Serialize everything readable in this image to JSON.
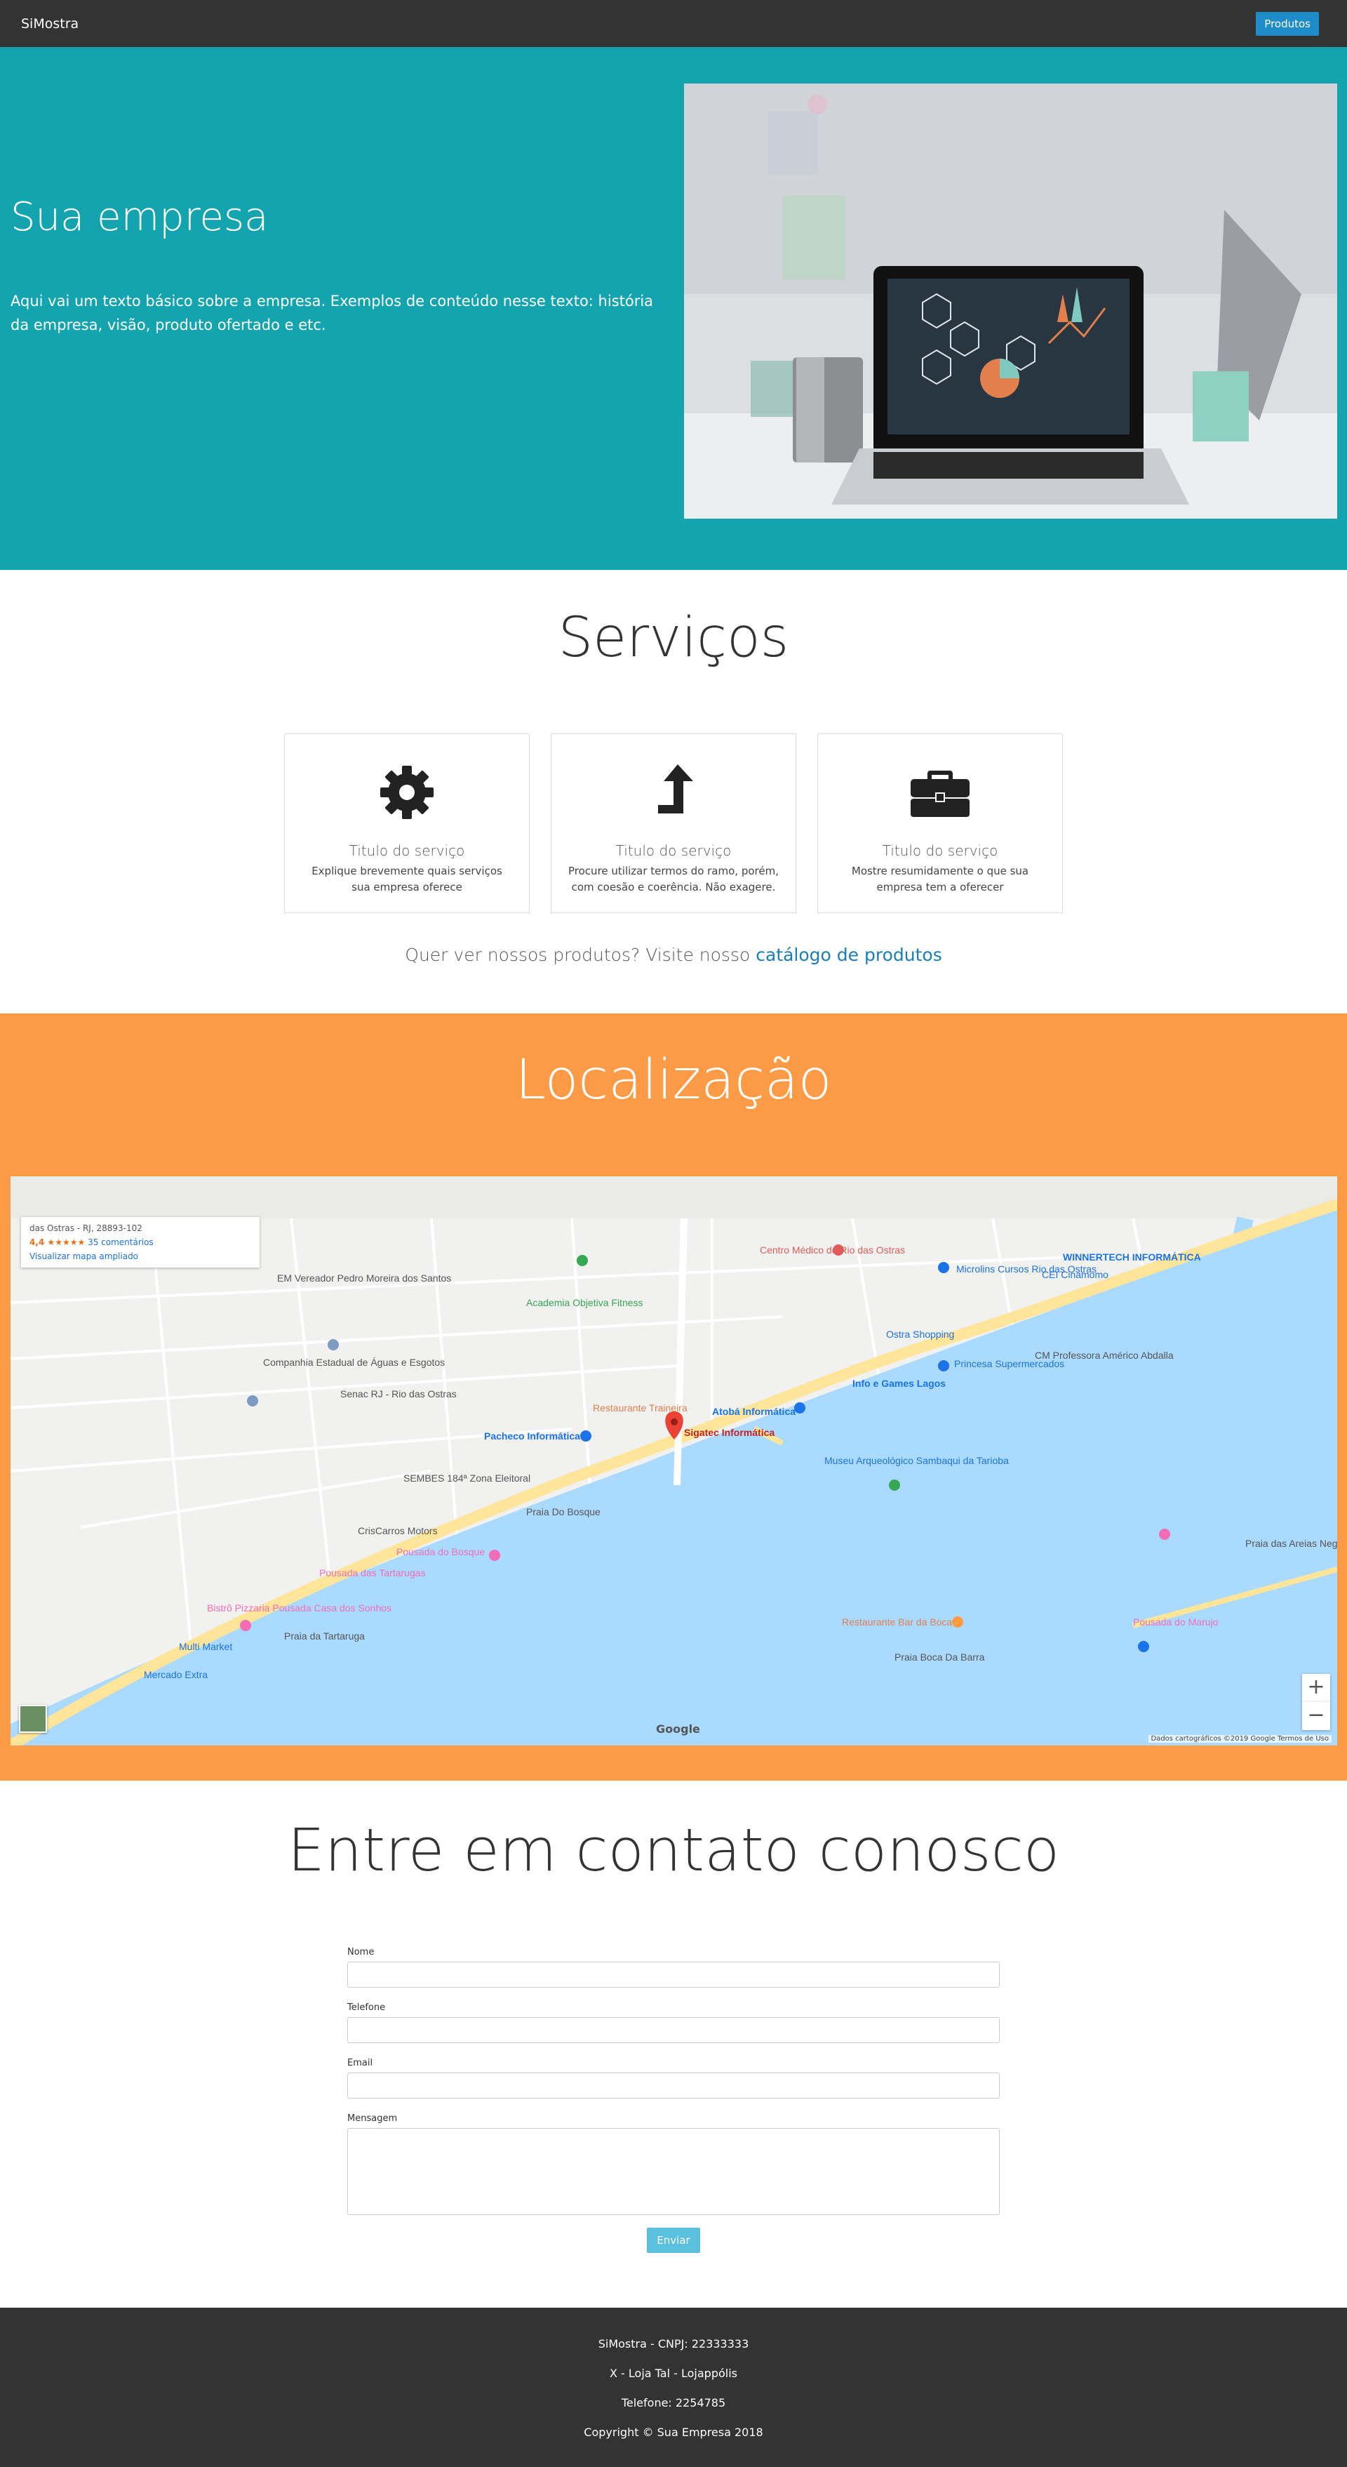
{
  "nav": {
    "brand": "SiMostra",
    "products_button": "Produtos"
  },
  "hero": {
    "title": "Sua empresa",
    "text": "Aqui vai um texto básico sobre a empresa. Exemplos de conteúdo nesse texto: história da empresa, visão, produto ofertado e etc."
  },
  "services": {
    "title": "Serviços",
    "cards": [
      {
        "icon": "gear-icon",
        "title": "Titulo do serviço",
        "desc": "Explique brevemente quais serviços sua empresa oferece"
      },
      {
        "icon": "arrow-up-icon",
        "title": "Titulo do serviço",
        "desc": "Procure utilizar termos do ramo, porém, com coesão e coerência. Não exagere."
      },
      {
        "icon": "briefcase-icon",
        "title": "Titulo do serviço",
        "desc": "Mostre resumidamente o que sua empresa tem a oferecer"
      }
    ],
    "catalog_text": "Quer ver nossos produtos? Visite nosso",
    "catalog_link": "catálogo de produtos"
  },
  "location": {
    "title": "Localização",
    "map": {
      "address": "das Ostras - RJ, 28893-102",
      "rating": "4,4 ★★★★★",
      "reviews": "35 comentários",
      "bigger_map": "Visualizar mapa ampliado",
      "pin_label": "Sigatec Informática",
      "labels": [
        "Centro Médico de Rio das Ostras",
        "Academia Objetiva Fitness",
        "Atobá Informática",
        "Pacheco Informática",
        "Praia Do Bosque",
        "Pousada das Tartarugas",
        "Restaurante Traineira",
        "Museu Arqueológico Sambaqui da Tarioba",
        "Restaurante Bar da Boca",
        "Praia Boca Da Barra",
        "CrisCarros Motors",
        "Info e Games Lagos",
        "Ostra Shopping",
        "Princesa Supermercados",
        "Mercado Extra",
        "Multi Market",
        "WINNERTECH INFORMÁTICA",
        "Microlins Cursos Rio das Ostras"
      ],
      "zoom_in": "+",
      "zoom_out": "−",
      "google": "Google",
      "credit": "Dados cartográficos ©2019 Google   Termos de Uso"
    }
  },
  "contact": {
    "title": "Entre em contato conosco",
    "name_label": "Nome",
    "phone_label": "Telefone",
    "email_label": "Email",
    "message_label": "Mensagem",
    "send_button": "Enviar"
  },
  "footer": {
    "line1": "SiMostra - CNPJ: 22333333",
    "line2": "X - Loja Tal - Lojappólis",
    "line3": "Telefone: 2254785",
    "line4": "Copyright © Sua Empresa 2018"
  },
  "colors": {
    "hero": "#14a4b0",
    "location": "#fd9a45",
    "nav": "#333333",
    "link": "#1b7fb6"
  }
}
